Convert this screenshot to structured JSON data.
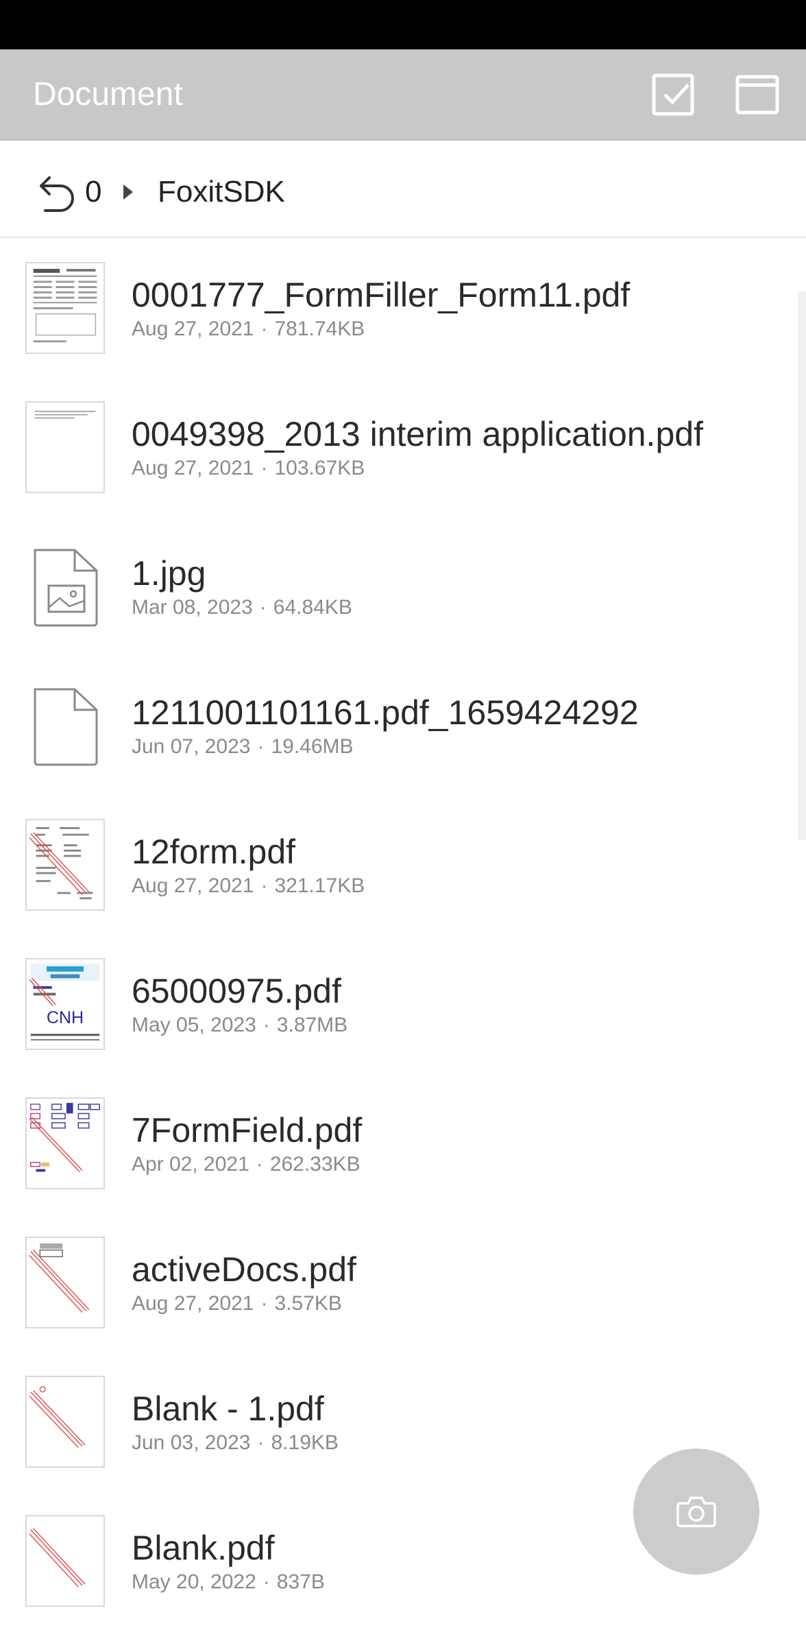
{
  "app_bar": {
    "title": "Document",
    "select_icon": "checkbox-select-icon",
    "window_icon": "window-icon"
  },
  "breadcrumb": {
    "back_icon": "back-arrow-icon",
    "level": "0",
    "folder": "FoxitSDK"
  },
  "files": [
    {
      "name": "0001777_FormFiller_Form11.pdf",
      "date": "Aug 27, 2021",
      "size": "781.74KB",
      "thumb": "form-thumbnail"
    },
    {
      "name": "0049398_2013 interim application.pdf",
      "date": "Aug 27, 2021",
      "size": "103.67KB",
      "thumb": "text-thumbnail"
    },
    {
      "name": "1.jpg",
      "date": "Mar 08, 2023",
      "size": "64.84KB",
      "thumb": "image-file-icon"
    },
    {
      "name": "1211001101161.pdf_1659424292",
      "date": "Jun 07, 2023",
      "size": "19.46MB",
      "thumb": "generic-file-icon"
    },
    {
      "name": "12form.pdf",
      "date": "Aug 27, 2021",
      "size": "321.17KB",
      "thumb": "form-watermark-thumbnail"
    },
    {
      "name": "65000975.pdf",
      "date": "May 05, 2023",
      "size": "3.87MB",
      "thumb": "brochure-thumbnail"
    },
    {
      "name": "7FormField.pdf",
      "date": "Apr 02, 2021",
      "size": "262.33KB",
      "thumb": "formfield-thumbnail"
    },
    {
      "name": "activeDocs.pdf",
      "date": "Aug 27, 2021",
      "size": "3.57KB",
      "thumb": "watermark-thumbnail"
    },
    {
      "name": "Blank - 1.pdf",
      "date": "Jun 03, 2023",
      "size": "8.19KB",
      "thumb": "watermark-thumbnail"
    },
    {
      "name": "Blank.pdf",
      "date": "May 20, 2022",
      "size": "837B",
      "thumb": "watermark-thumbnail"
    }
  ],
  "fab": {
    "icon": "camera-icon"
  },
  "colors": {
    "app_bar": "#c8c8c8",
    "fab": "#cccccc",
    "watermark": "#e05050"
  }
}
